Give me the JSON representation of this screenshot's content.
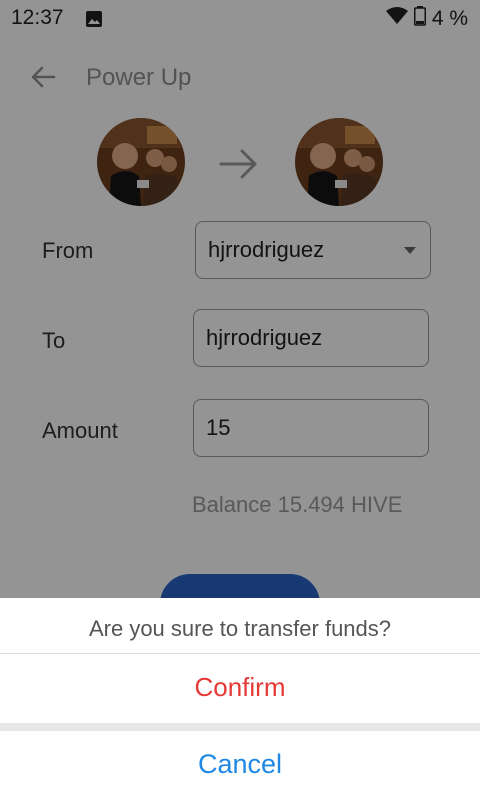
{
  "status_bar": {
    "time": "12:37",
    "battery": "4 %"
  },
  "header": {
    "title": "Power Up"
  },
  "form": {
    "from_label": "From",
    "from_value": "hjrrodriguez",
    "to_label": "To",
    "to_value": "hjrrodriguez",
    "amount_label": "Amount",
    "amount_value": "15",
    "balance": "Balance 15.494 HIVE"
  },
  "dialog": {
    "question": "Are you sure to transfer funds?",
    "confirm_label": "Confirm",
    "cancel_label": "Cancel"
  },
  "colors": {
    "confirm": "#e53935",
    "cancel": "#1e88e5",
    "primary_button": "#2c62c9"
  }
}
